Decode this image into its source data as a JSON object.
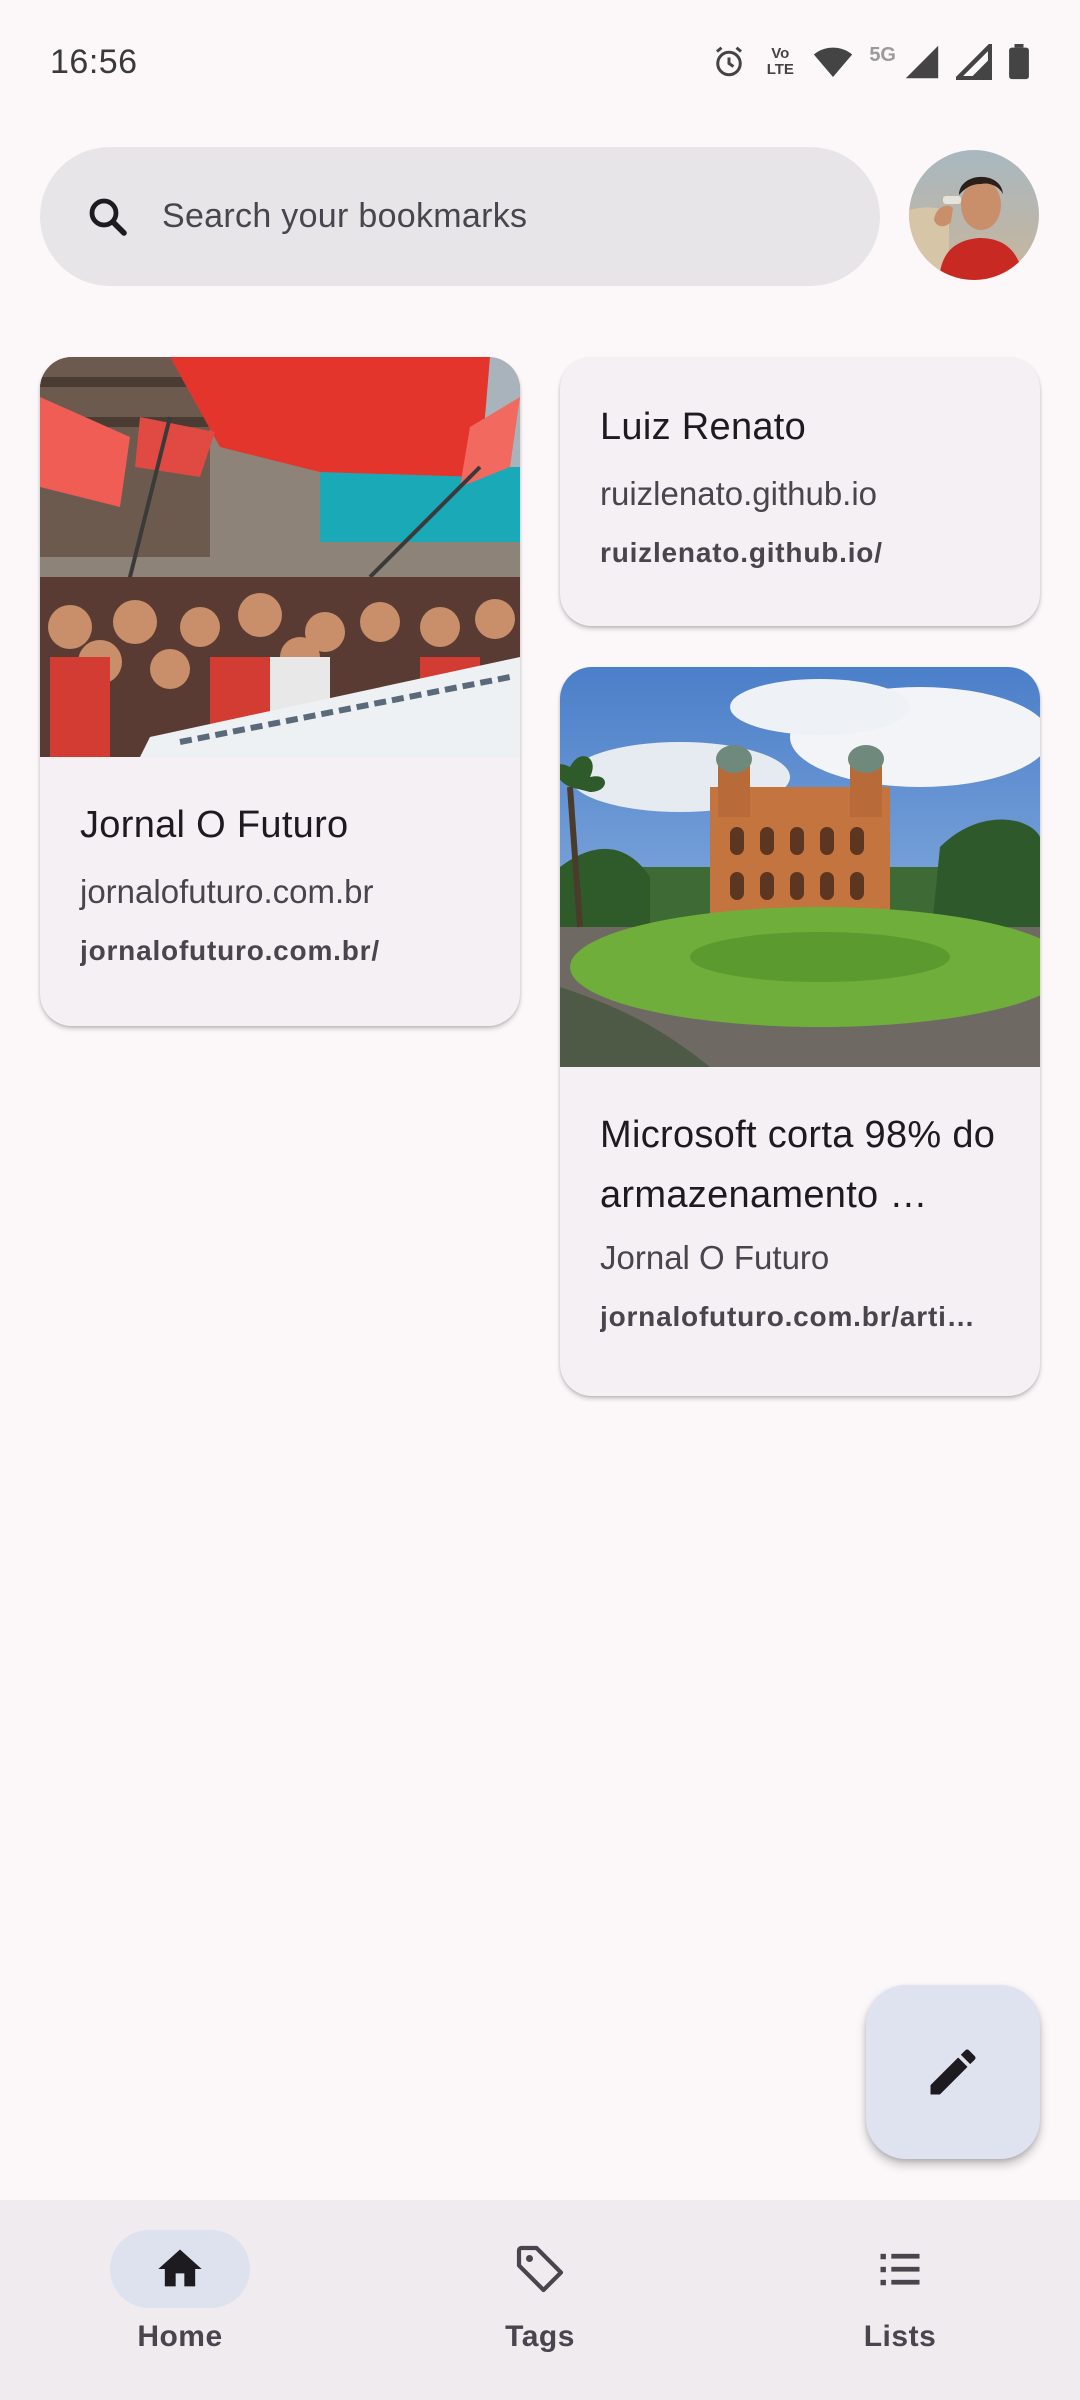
{
  "status_bar": {
    "time": "16:56",
    "network_label": "Vo LTE",
    "network_gen": "5G",
    "icons": [
      "alarm-icon",
      "volte-icon",
      "wifi-icon",
      "5g-icon",
      "signal-icon",
      "signal-icon",
      "battery-icon"
    ]
  },
  "search": {
    "placeholder": "Search your bookmarks",
    "icon": "search-icon"
  },
  "avatar": {
    "icon": "avatar"
  },
  "bookmarks": [
    {
      "title": "Jornal O Futuro",
      "subtitle": "jornalofuturo.com.br",
      "url": "jornalofuturo.com.br/",
      "image": "protest-photo"
    },
    {
      "title": "Luiz Renato",
      "subtitle": "ruizlenato.github.io",
      "url": "ruizlenato.github.io/"
    },
    {
      "title": "Microsoft corta 98% do armazenamento …",
      "subtitle": "Jornal O Futuro",
      "url": "jornalofuturo.com.br/arti…",
      "image": "castle-photo"
    }
  ],
  "fab": {
    "icon": "edit-icon"
  },
  "nav": [
    {
      "label": "Home",
      "icon": "home-icon",
      "active": true
    },
    {
      "label": "Tags",
      "icon": "tag-icon",
      "active": false
    },
    {
      "label": "Lists",
      "icon": "list-icon",
      "active": false
    }
  ],
  "colors": {
    "background": "#fcf8fa",
    "card": "#f4f0f3",
    "search": "#e8e5e8",
    "fab": "#dee3ef",
    "nav_bar": "#efebee",
    "nav_active": "#dde2ee"
  }
}
